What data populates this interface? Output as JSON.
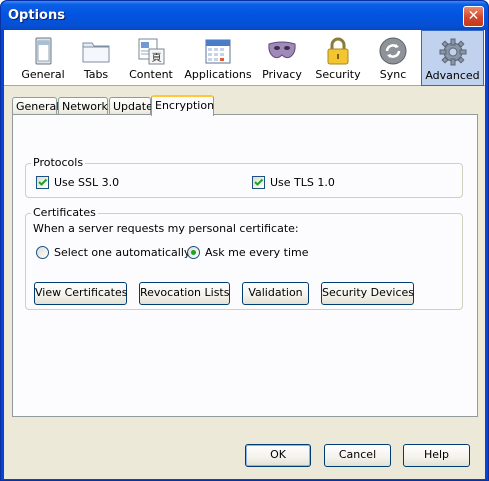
{
  "window": {
    "title": "Options",
    "close_symbol": "✕"
  },
  "toolbar": {
    "items": [
      {
        "label": "General",
        "icon": "window-icon"
      },
      {
        "label": "Tabs",
        "icon": "folder-tabs-icon"
      },
      {
        "label": "Content",
        "icon": "content-page-icon"
      },
      {
        "label": "Applications",
        "icon": "applications-calendar-icon"
      },
      {
        "label": "Privacy",
        "icon": "privacy-mask-icon"
      },
      {
        "label": "Security",
        "icon": "padlock-icon"
      },
      {
        "label": "Sync",
        "icon": "sync-arrows-icon"
      },
      {
        "label": "Advanced",
        "icon": "gear-icon"
      }
    ],
    "selected": "Advanced"
  },
  "tabs": [
    {
      "label": "General"
    },
    {
      "label": "Network"
    },
    {
      "label": "Update"
    },
    {
      "label": "Encryption"
    }
  ],
  "active_tab": "Encryption",
  "protocols": {
    "label": "Protocols",
    "ssl": {
      "label": "Use SSL 3.0",
      "checked": true
    },
    "tls": {
      "label": "Use TLS 1.0",
      "checked": true
    }
  },
  "certificates": {
    "label": "Certificates",
    "prompt": "When a server requests my personal certificate:",
    "option_auto": {
      "label": "Select one automatically",
      "selected": false
    },
    "option_ask": {
      "label": "Ask me every time",
      "selected": true
    },
    "buttons": {
      "view": "View Certificates",
      "revocation": "Revocation Lists",
      "validation": "Validation",
      "devices": "Security Devices"
    }
  },
  "footer": {
    "ok": "OK",
    "cancel": "Cancel",
    "help": "Help"
  },
  "colors": {
    "title_bar": "#0254e0",
    "selected_toolbar": "#c1d2ee",
    "tab_highlight": "#ffc83c"
  }
}
